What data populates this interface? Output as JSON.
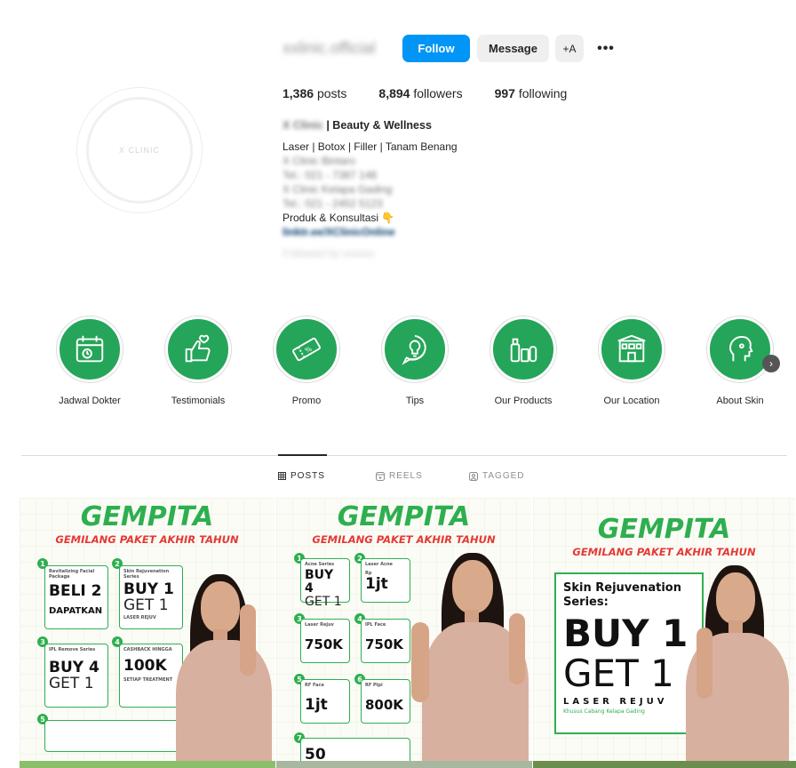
{
  "profile": {
    "username": "xxlinic.official",
    "buttons": {
      "follow": "Follow",
      "message": "Message",
      "add_user": "+A",
      "more": "•••"
    },
    "stats": [
      {
        "value": "1,386",
        "label": "posts"
      },
      {
        "value": "8,894",
        "label": "followers"
      },
      {
        "value": "997",
        "label": "following"
      }
    ],
    "bio": {
      "name_blurred": "X Clinic",
      "category": "| Beauty & Wellness",
      "lines": [
        "Laser | Botox | Filler | Tanam Benang"
      ],
      "blurred_lines": [
        "X Clinic Bintaro",
        "Tel.: 021 - 7387 148",
        "X Clinic Kelapa Gading",
        "Tel.: 021 - 2452 5123"
      ],
      "cta": "Produk & Konsultasi 👇",
      "link": "linktr.ee/XClinicOnline",
      "faint_line": "Followed by xxxxxx"
    },
    "avatar_text": "X CLINIC"
  },
  "highlights": [
    {
      "label": "Jadwal Dokter",
      "icon": "calendar-icon"
    },
    {
      "label": "Testimonials",
      "icon": "thumbs-up-icon"
    },
    {
      "label": "Promo",
      "icon": "ticket-icon"
    },
    {
      "label": "Tips",
      "icon": "lightbulb-icon"
    },
    {
      "label": "Our Products",
      "icon": "products-icon"
    },
    {
      "label": "Our Location",
      "icon": "building-icon"
    },
    {
      "label": "About Skin",
      "icon": "face-icon"
    }
  ],
  "tabs": [
    {
      "label": "POSTS",
      "icon": "grid-icon",
      "active": true
    },
    {
      "label": "REELS",
      "icon": "reels-icon",
      "active": false
    },
    {
      "label": "TAGGED",
      "icon": "tag-icon",
      "active": false
    }
  ],
  "posts": {
    "title": "GEMPITA",
    "subtitle": "GEMILANG PAKET AKHIR TAHUN",
    "post1": {
      "boxes": [
        {
          "n": "1",
          "small": "Revitalizing Facial Package",
          "big": "BELI 2",
          "extra": "DAPATKAN"
        },
        {
          "n": "2",
          "small": "Skin Rejuvenation Series",
          "big": "BUY 1",
          "thin": "GET 1",
          "extra": "LASER REJUV"
        },
        {
          "n": "3",
          "small": "IPL Remove Series",
          "big": "BUY 4",
          "thin": "GET 1"
        },
        {
          "n": "4",
          "small": "CASHBACK HINGGA",
          "big": "100K",
          "extra": "SETIAP TREATMENT"
        }
      ],
      "n5": "5"
    },
    "post2": {
      "boxes": [
        {
          "n": "1",
          "small": "Acne Series",
          "big": "BUY 4",
          "thin": "GET 1"
        },
        {
          "n": "2",
          "small": "Laser Acne",
          "mid": "Rp",
          "big": "1jt"
        },
        {
          "n": "3",
          "small": "Laser Rejuv",
          "big": "750K"
        },
        {
          "n": "4",
          "small": "IPL Face",
          "big": "750K"
        },
        {
          "n": "5",
          "small": "RF Face",
          "big": "1jt"
        },
        {
          "n": "6",
          "small": "RF Pipi",
          "big": "800K"
        }
      ],
      "n7": "7",
      "last": "50"
    },
    "post3": {
      "s1a": "Skin Rejuvenation",
      "s1b": "Series:",
      "buy": "BUY 1",
      "get": "GET 1",
      "laser": "LASER REJUV",
      "tiny": "Khusus Cabang Kelapa Gading"
    }
  },
  "colors": {
    "accent": "#25a55a",
    "follow": "#0095f6",
    "promo_red": "#e53935"
  }
}
